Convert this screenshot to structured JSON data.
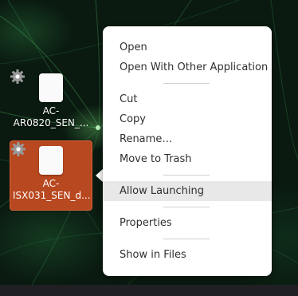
{
  "desktop": {
    "icons": [
      {
        "label": "AC-\nAR0820_SEN_...",
        "icon": "gear-icon",
        "selected": false
      },
      {
        "label": "AC-\nISX031_SEN_d...",
        "icon": "gear-icon",
        "selected": true
      }
    ]
  },
  "context_menu": {
    "items": [
      {
        "label": "Open"
      },
      {
        "label": "Open With Other Application"
      },
      {
        "label": "Cut"
      },
      {
        "label": "Copy"
      },
      {
        "label": "Rename…"
      },
      {
        "label": "Move to Trash"
      },
      {
        "label": "Allow Launching",
        "highlighted": true
      },
      {
        "label": "Properties"
      },
      {
        "label": "Show in Files"
      }
    ]
  },
  "colors": {
    "selection": "#b8481f",
    "menu_bg": "#ffffff",
    "menu_hover": "#e8e8e8",
    "panel": "#202024"
  }
}
